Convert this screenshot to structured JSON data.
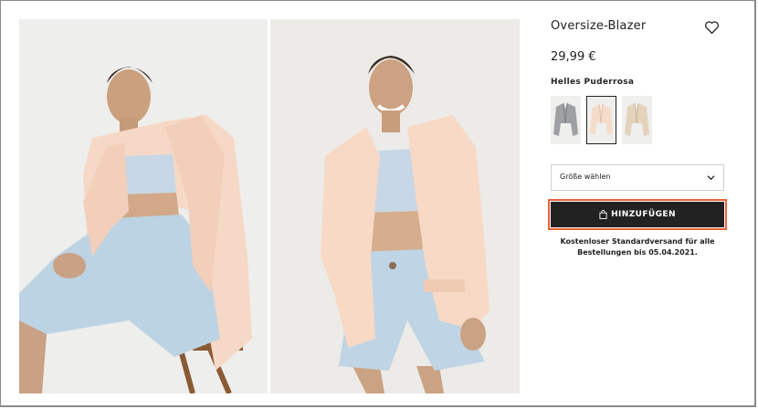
{
  "product": {
    "title": "Oversize-Blazer",
    "price": "29,99 €",
    "color_name": "Helles Puderrosa",
    "swatches": [
      {
        "color": "#9ea0a3",
        "selected": false,
        "icon": "blazer-grey"
      },
      {
        "color": "#f4dccb",
        "selected": true,
        "icon": "blazer-light-pink"
      },
      {
        "color": "#e3d3bd",
        "selected": false,
        "icon": "blazer-beige"
      }
    ]
  },
  "size_select": {
    "label": "Größe wählen",
    "icon": "chevron-down-icon"
  },
  "add_button": {
    "label": "HINZUFÜGEN",
    "icon": "bag-icon"
  },
  "shipping_note": "Kostenloser Standardversand für alle Bestellungen bis 05.04.2021.",
  "colors": {
    "button_bg": "#222222",
    "focus_outline": "#e8623a",
    "blazer": "#f6d8c6",
    "shorts": "#bcd3e3",
    "top": "#c7d7e6",
    "background": "#ececea"
  }
}
